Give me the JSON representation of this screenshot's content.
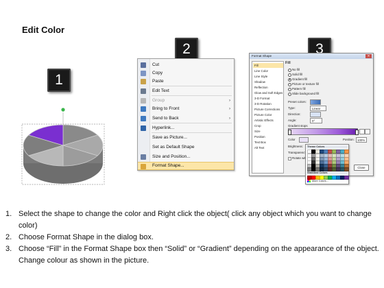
{
  "page": {
    "title": "Edit Color"
  },
  "badges": [
    "1",
    "2",
    "3"
  ],
  "pie": {
    "slice_colors": [
      "#8a8a8a",
      "#a9a9a9",
      "#9c9c9c",
      "#b8b8b8",
      "#7e7e7e",
      "#7a2fd0"
    ],
    "highlight_color": "#7a2fd0",
    "handle_color": "#39b54a"
  },
  "context_menu": {
    "items": [
      {
        "label": "Cut",
        "icon": "scissors-icon",
        "color": "#5a6f9e",
        "submenu": false,
        "disabled": false
      },
      {
        "label": "Copy",
        "icon": "copy-icon",
        "color": "#7d95c4",
        "submenu": false,
        "disabled": false
      },
      {
        "label": "Paste",
        "icon": "paste-icon",
        "color": "#c9a24a",
        "submenu": false,
        "disabled": false
      },
      {
        "label": "Edit Text",
        "icon": "edit-text-icon",
        "color": "#6b7a8f",
        "submenu": false,
        "disabled": false
      },
      {
        "label": "Group",
        "icon": "group-icon",
        "color": "#b7b7b7",
        "submenu": true,
        "disabled": true
      },
      {
        "label": "Bring to Front",
        "icon": "bring-front-icon",
        "color": "#3f7ac0",
        "submenu": true,
        "disabled": false
      },
      {
        "label": "Send to Back",
        "icon": "send-back-icon",
        "color": "#3f7ac0",
        "submenu": true,
        "disabled": false
      },
      {
        "label": "Hyperlink...",
        "icon": "hyperlink-icon",
        "color": "#2f64a8",
        "submenu": false,
        "disabled": false
      },
      {
        "label": "Save as Picture...",
        "icon": "",
        "color": "",
        "submenu": false,
        "disabled": false
      },
      {
        "label": "Set as Default Shape",
        "icon": "",
        "color": "",
        "submenu": false,
        "disabled": false
      },
      {
        "label": "Size and Position...",
        "icon": "size-position-icon",
        "color": "#6a7ea3",
        "submenu": false,
        "disabled": false
      },
      {
        "label": "Format Shape...",
        "icon": "format-shape-icon",
        "color": "#d9a53c",
        "submenu": false,
        "disabled": false
      }
    ],
    "arrow": "›"
  },
  "format_dialog": {
    "title": "Format Shape",
    "close_glyph": "✕",
    "categories": [
      "Fill",
      "Line Color",
      "Line Style",
      "Shadow",
      "Reflection",
      "Glow and Soft Edges",
      "3-D Format",
      "3-D Rotation",
      "Picture Corrections",
      "Picture Color",
      "Artistic Effects",
      "Crop",
      "Size",
      "Position",
      "Text Box",
      "Alt Text"
    ],
    "selected_category": "Fill",
    "section_title": "Fill",
    "fill_options": [
      "No fill",
      "Solid fill",
      "Gradient fill",
      "Picture or texture fill",
      "Pattern fill",
      "Slide background fill"
    ],
    "selected_fill": "Gradient fill",
    "labels": {
      "preset": "Preset colors:",
      "type": "Type:",
      "direction": "Direction:",
      "angle": "Angle:",
      "stops": "Gradient stops",
      "color": "Color",
      "position": "Position:",
      "brightness": "Brightness:",
      "transparency": "Transparency:",
      "rotate": "Rotate with shape",
      "close": "Close"
    },
    "values": {
      "type": "Linear",
      "angle": "0°",
      "position": "100%"
    }
  },
  "color_popup": {
    "theme_header": "Theme Colors",
    "standard_header": "Standard Colors",
    "more": "More Colors...",
    "theme_top": [
      "#ffffff",
      "#000000",
      "#eeece1",
      "#1f497d",
      "#4f81bd",
      "#c0504d",
      "#9bbb59",
      "#8064a2",
      "#4bacc6",
      "#f79646"
    ],
    "standard": [
      "#c00000",
      "#ff0000",
      "#ffc000",
      "#ffff00",
      "#92d050",
      "#00b050",
      "#00b0f0",
      "#0070c0",
      "#002060",
      "#7030a0"
    ]
  },
  "instructions": [
    {
      "num": "1.",
      "text": "Select the shape to change the color and Right click the object( click any object which you want to change color)"
    },
    {
      "num": "2.",
      "text": "Choose Format Shape in the dialog box."
    },
    {
      "num": "3.",
      "text": "Choose “Fill” in the Format Shape box then “Solid” or “Gradient” depending on the appearance of the object. Change colour as shown in the picture."
    }
  ]
}
